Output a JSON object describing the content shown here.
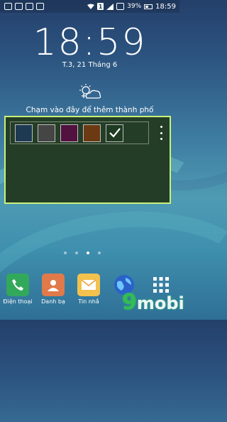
{
  "status_bar": {
    "battery": "39%",
    "time": "18:59",
    "sim_label": "1"
  },
  "lockscreen": {
    "clock": "18:59",
    "date": "T.3, 21 Tháng 6",
    "weather_hint": "Chạm vào đây để thêm thành phố"
  },
  "color_picker": {
    "swatches": [
      {
        "name": "dark-teal",
        "color": "#1d3a52"
      },
      {
        "name": "dark-gray",
        "color": "#454545"
      },
      {
        "name": "dark-purple",
        "color": "#52113f"
      },
      {
        "name": "brown",
        "color": "#6b3a12"
      },
      {
        "name": "dark-green",
        "color": "#1f3b22",
        "selected": true
      }
    ]
  },
  "dock": {
    "apps": [
      {
        "label": "Điện thoại",
        "icon": "phone-icon",
        "color": "#32a85a"
      },
      {
        "label": "Danh bạ",
        "icon": "contacts-icon",
        "color": "#e07a4a"
      },
      {
        "label": "Tin nhắ",
        "icon": "messages-icon",
        "color": "#f2c14e"
      },
      {
        "label": "",
        "icon": "internet-icon",
        "color": "#2a62c9"
      },
      {
        "label": "",
        "icon": "apps-grid-icon",
        "color": "#ffffff"
      }
    ],
    "watermark": "9mobi"
  }
}
